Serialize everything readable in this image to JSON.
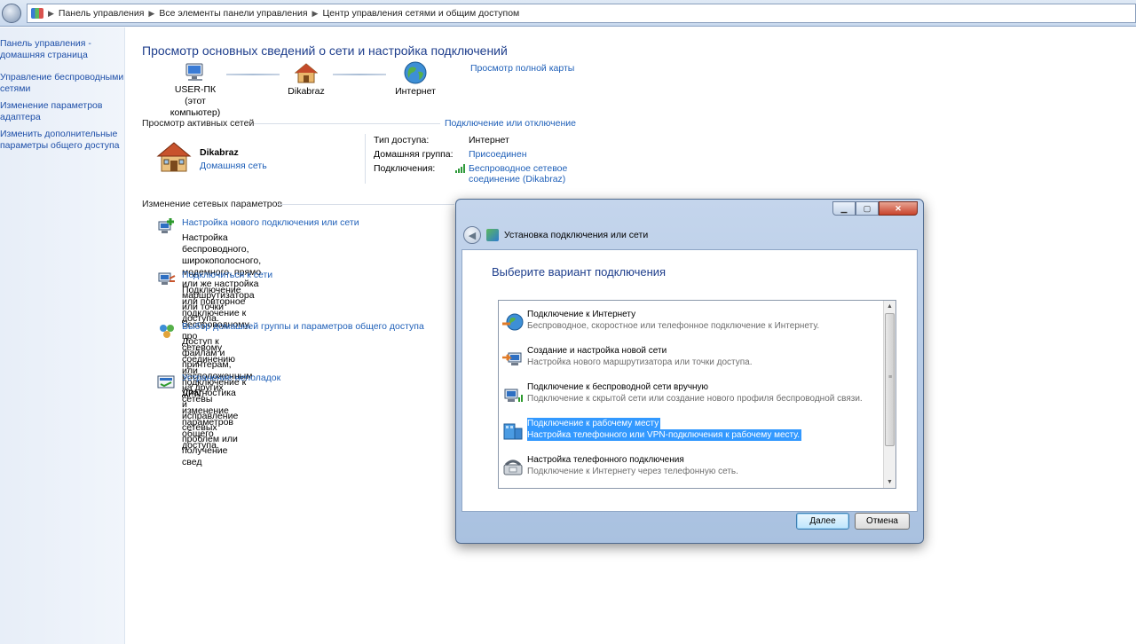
{
  "address_bar": {
    "crumbs": [
      "Панель управления",
      "Все элементы панели управления",
      "Центр управления сетями и общим доступом"
    ]
  },
  "leftnav": {
    "items": [
      "Панель управления -\nдомашняя страница",
      "Управление беспроводными\nсетями",
      "Изменение параметров\nадаптера",
      "Изменить дополнительные\nпараметры общего доступа"
    ]
  },
  "main": {
    "title": "Просмотр основных сведений о сети и настройка подключений",
    "view_full_map": "Просмотр полной карты",
    "map": {
      "computer_name": "USER-ПК",
      "computer_sub": "(этот компьютер)",
      "network_name": "Dikabraz",
      "internet": "Интернет"
    },
    "active_networks": {
      "title": "Просмотр активных сетей",
      "connect_disconnect": "Подключение или отключение",
      "network_name": "Dikabraz",
      "network_type": "Домашняя сеть",
      "access_type_label": "Тип доступа:",
      "access_type_value": "Интернет",
      "homegroup_label": "Домашняя группа:",
      "homegroup_value": "Присоединен",
      "connections_label": "Подключения:",
      "connections_value_1": "Беспроводное сетевое",
      "connections_value_2": "соединение (Dikabraz)"
    },
    "change_settings": {
      "title": "Изменение сетевых параметров",
      "tasks": [
        {
          "title": "Настройка нового подключения или сети",
          "desc": "Настройка беспроводного, широкополосного, модемного, прямо\nили же настройка маршрутизатора или точки доступа."
        },
        {
          "title": "Подключиться к сети",
          "desc": "Подключение или повторное подключение к беспроводному, про\nсетевому соединению или подключение к VPN."
        },
        {
          "title": "Выбор домашней группы и параметров общего доступа",
          "desc": "Доступ к файлам и принтерам, расположенным на других сетевы\nизменение параметров общего доступа."
        },
        {
          "title": "Устранение неполадок",
          "desc": "Диагностика и исправление сетевых проблем или получение свед"
        }
      ]
    }
  },
  "dialog": {
    "title": "Установка подключения или сети",
    "heading": "Выберите вариант подключения",
    "selected_index": 3,
    "options": [
      {
        "title": "Подключение к Интернету",
        "desc": "Беспроводное, скоростное или телефонное подключение к Интернету.",
        "icon": "globe-icon"
      },
      {
        "title": "Создание и настройка новой сети",
        "desc": "Настройка нового маршрутизатора или точки доступа.",
        "icon": "router-icon"
      },
      {
        "title": "Подключение к беспроводной сети вручную",
        "desc": "Подключение к скрытой сети или создание нового профиля беспроводной связи.",
        "icon": "wireless-icon"
      },
      {
        "title": "Подключение к рабочему месту",
        "desc": "Настройка телефонного или VPN-подключения к рабочему месту.",
        "icon": "workplace-icon"
      },
      {
        "title": "Настройка телефонного подключения",
        "desc": "Подключение к Интернету через телефонную сеть.",
        "icon": "phone-icon"
      }
    ],
    "next_label": "Далее",
    "cancel_label": "Отмена"
  },
  "colors": {
    "link": "#1e5fb8",
    "heading": "#1e3e8c",
    "selection": "#3399ff"
  }
}
